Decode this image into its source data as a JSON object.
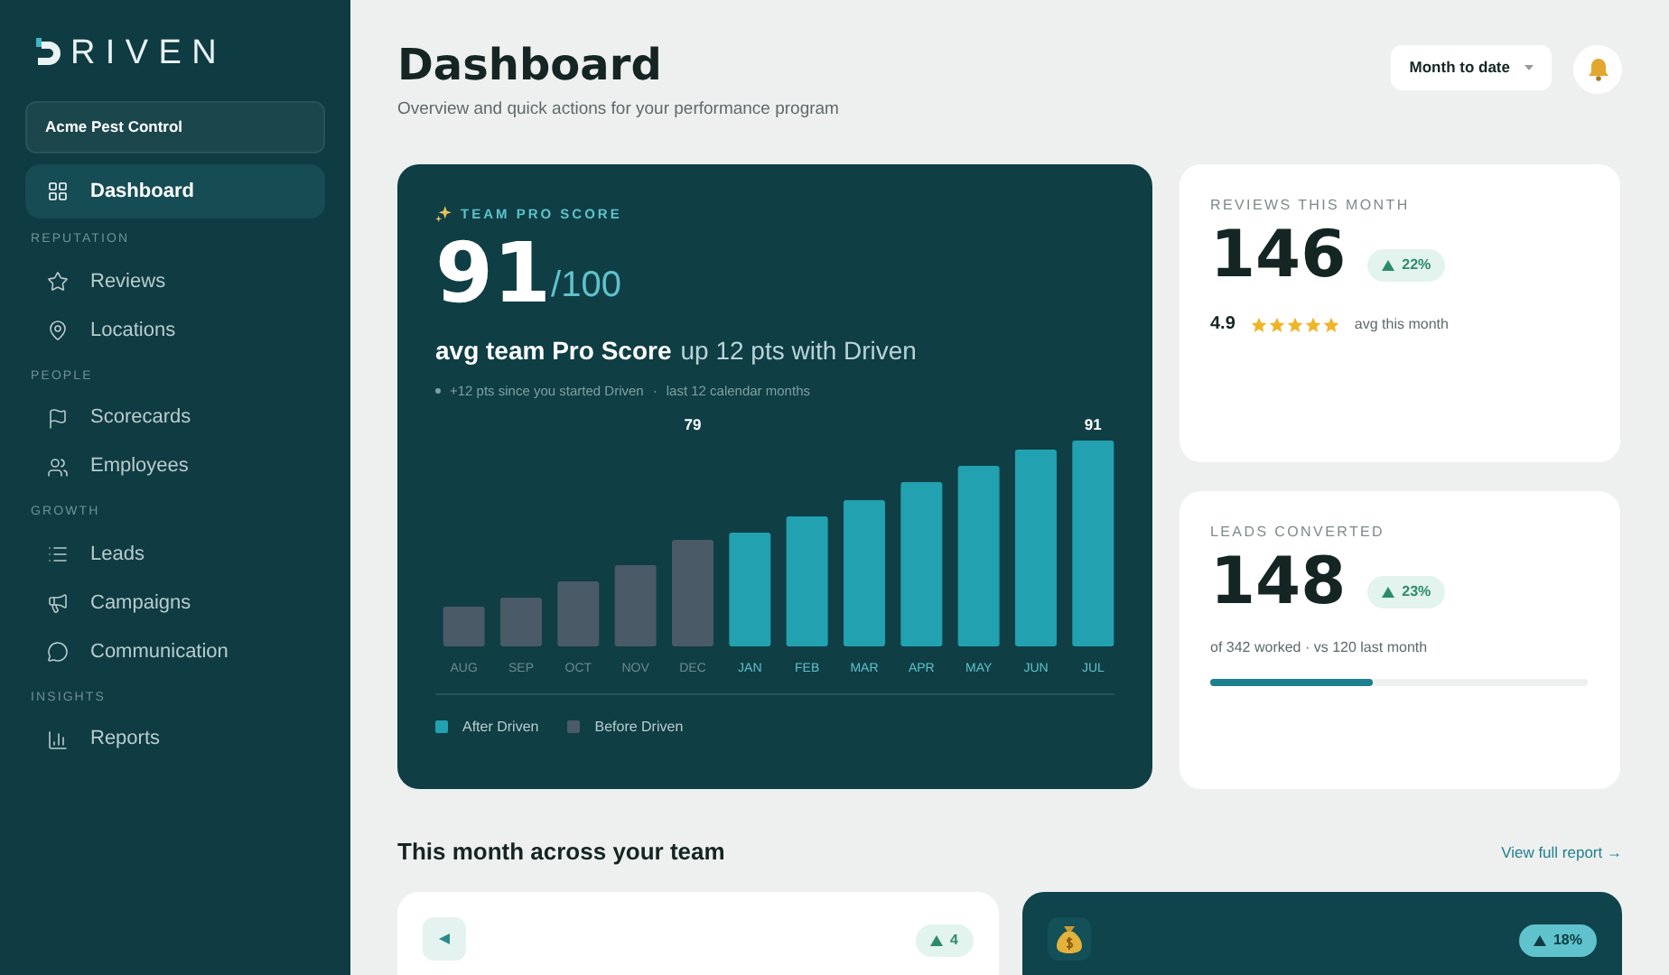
{
  "brand": {
    "wordmark": "RIVEN"
  },
  "account": {
    "name": "Acme Pest Control"
  },
  "sidebar": {
    "top_item": {
      "label": "Dashboard",
      "selected": true
    },
    "sections": [
      {
        "title": "REPUTATION",
        "items": [
          {
            "label": "Reviews",
            "selected": false
          },
          {
            "label": "Locations",
            "selected": false
          }
        ]
      },
      {
        "title": "PEOPLE",
        "items": [
          {
            "label": "Scorecards",
            "selected": false
          },
          {
            "label": "Employees",
            "selected": false
          }
        ]
      },
      {
        "title": "GROWTH",
        "items": [
          {
            "label": "Leads",
            "selected": false
          },
          {
            "label": "Campaigns",
            "selected": false
          },
          {
            "label": "Communication",
            "selected": false
          }
        ]
      },
      {
        "title": "INSIGHTS",
        "items": [
          {
            "label": "Reports",
            "selected": false
          }
        ]
      }
    ]
  },
  "header": {
    "title": "Dashboard",
    "subtitle": "Overview and quick actions for your performance program",
    "period": "Month to date"
  },
  "hero": {
    "eyebrow": "TEAM PRO SCORE",
    "score": "91",
    "out_of": "/100",
    "headline": "avg team Pro Score",
    "headline_rest": "up 12 pts with Driven",
    "note": "+12 pts since you started Driven",
    "note_sep": "·",
    "note_range": "last 12 calendar months",
    "trend": {
      "callouts": [
        "79",
        "91"
      ],
      "months": [
        {
          "label": "AUG",
          "kind": "before"
        },
        {
          "label": "SEP",
          "kind": "before"
        },
        {
          "label": "OCT",
          "kind": "before"
        },
        {
          "label": "NOV",
          "kind": "before"
        },
        {
          "label": "DEC",
          "kind": "before"
        },
        {
          "label": "JAN",
          "kind": "after"
        },
        {
          "label": "FEB",
          "kind": "after"
        },
        {
          "label": "MAR",
          "kind": "after"
        },
        {
          "label": "APR",
          "kind": "after"
        },
        {
          "label": "MAY",
          "kind": "after"
        },
        {
          "label": "JUN",
          "kind": "after"
        },
        {
          "label": "JUL",
          "kind": "after"
        }
      ],
      "legend": [
        {
          "name": "After Driven",
          "color": "#22a1b0"
        },
        {
          "name": "Before Driven",
          "color": "#4a5a66"
        }
      ]
    }
  },
  "stats": [
    {
      "kind": "rating",
      "label": "REVIEWS THIS MONTH",
      "value": "146",
      "delta": "22%",
      "rating": "4.9",
      "stars": 5,
      "caption": "avg this month"
    },
    {
      "kind": "progress",
      "label": "LEADS CONVERTED",
      "value": "148",
      "delta": "23%",
      "caption": "of 342 worked · vs 120 last month",
      "level": 0.43
    }
  ],
  "team": {
    "title": "This month across your team",
    "link": "View full report →",
    "cards": [
      {
        "kind": "light",
        "delta": "4"
      },
      {
        "kind": "dark",
        "delta": "18%"
      }
    ]
  }
}
